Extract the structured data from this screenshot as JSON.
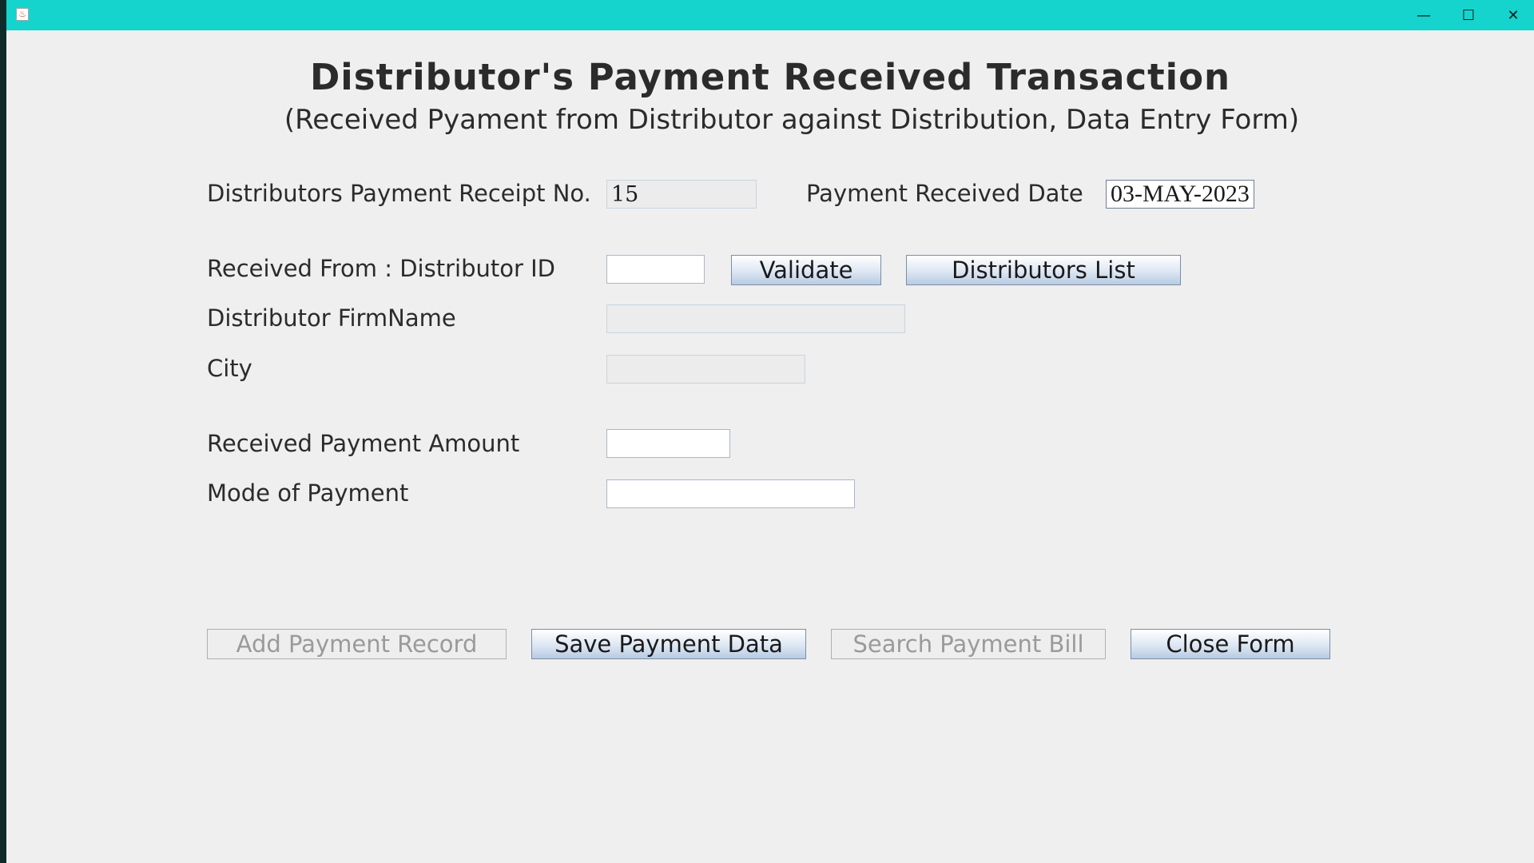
{
  "window": {
    "minimize_glyph": "—",
    "maximize_glyph": "☐",
    "close_glyph": "✕"
  },
  "header": {
    "title": "Distributor's Payment Received Transaction",
    "subtitle": "(Received Pyament from Distributor against Distribution, Data Entry Form)"
  },
  "form": {
    "receipt_no_label": "Distributors Payment Receipt No.",
    "receipt_no_value": "15",
    "received_date_label": "Payment Received Date",
    "received_date_value": "03-MAY-2023",
    "distributor_id_label": "Received From : Distributor ID",
    "distributor_id_value": "",
    "validate_label": "Validate",
    "distributors_list_label": "Distributors List",
    "firm_name_label": "Distributor FirmName",
    "firm_name_value": "",
    "city_label": "City",
    "city_value": "",
    "amount_label": "Received Payment Amount",
    "amount_value": "",
    "mode_label": "Mode of Payment",
    "mode_value": ""
  },
  "actions": {
    "add_label": "Add Payment Record",
    "save_label": "Save Payment Data",
    "search_label": "Search Payment Bill",
    "close_label": "Close Form"
  },
  "icons": {
    "app": "java-app-icon",
    "minimize": "minimize-icon",
    "maximize": "maximize-icon",
    "close": "close-icon"
  },
  "colors": {
    "titlebar": "#15d4cd",
    "background": "#efefef"
  }
}
